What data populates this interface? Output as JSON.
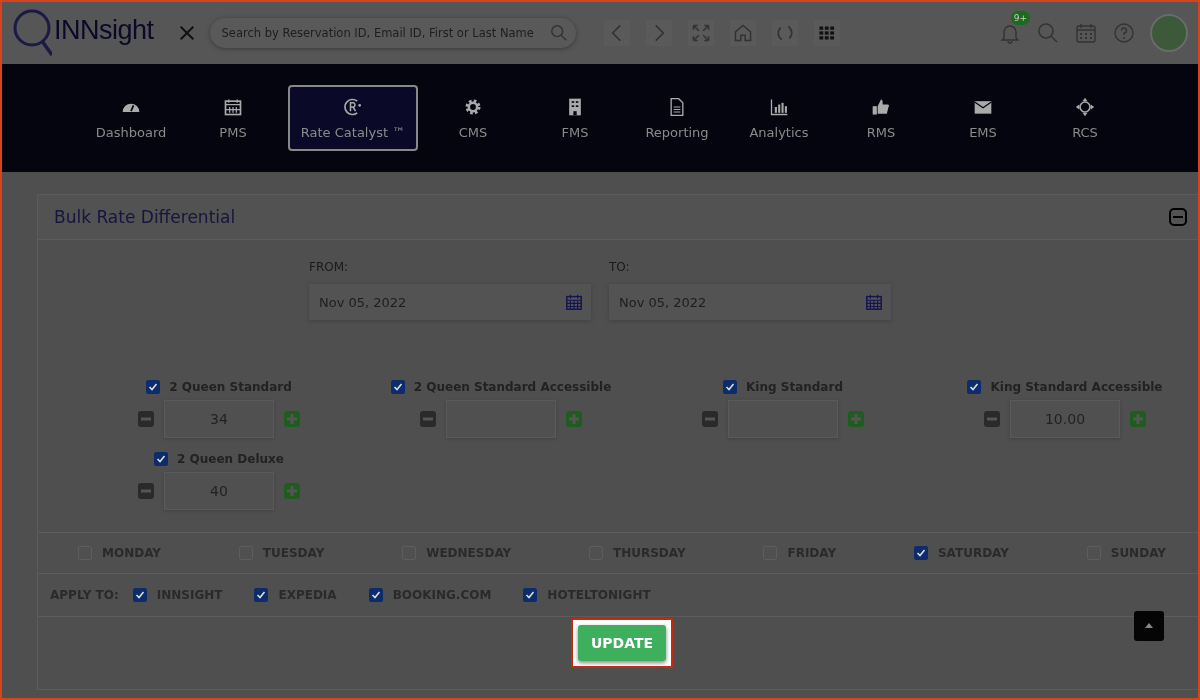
{
  "header": {
    "logo": "INNsight",
    "search": {
      "placeholder": "Search by Reservation ID, Email ID, First or Last Name"
    },
    "notification_badge": "9+"
  },
  "nav": [
    {
      "label": "Dashboard",
      "selected": false
    },
    {
      "label": "PMS",
      "selected": false
    },
    {
      "label": "Rate Catalyst ™",
      "selected": true
    },
    {
      "label": "CMS",
      "selected": false
    },
    {
      "label": "FMS",
      "selected": false
    },
    {
      "label": "Reporting",
      "selected": false
    },
    {
      "label": "Analytics",
      "selected": false
    },
    {
      "label": "RMS",
      "selected": false
    },
    {
      "label": "EMS",
      "selected": false
    },
    {
      "label": "RCS",
      "selected": false
    }
  ],
  "panel": {
    "title": "Bulk Rate Differential",
    "from": {
      "label": "FROM:",
      "value": "Nov 05, 2022"
    },
    "to": {
      "label": "TO:",
      "value": "Nov 05, 2022"
    }
  },
  "rooms": [
    {
      "name": "2 Queen Standard",
      "checked": true,
      "value": "34"
    },
    {
      "name": "2 Queen Standard Accessible",
      "checked": true
    },
    {
      "name": "King Standard",
      "checked": true
    },
    {
      "name": "King Standard Accessible",
      "checked": true,
      "value": "10.00"
    },
    {
      "name": "2 Queen Deluxe",
      "checked": true,
      "value": "40"
    }
  ],
  "days": [
    {
      "label": "MONDAY",
      "checked": false
    },
    {
      "label": "TUESDAY",
      "checked": false
    },
    {
      "label": "WEDNESDAY",
      "checked": false
    },
    {
      "label": "THURSDAY",
      "checked": false
    },
    {
      "label": "FRIDAY",
      "checked": false
    },
    {
      "label": "SATURDAY",
      "checked": true
    },
    {
      "label": "SUNDAY",
      "checked": false
    }
  ],
  "apply_to": {
    "label": "APPLY TO:",
    "channels": [
      {
        "label": "INNSIGHT",
        "checked": true
      },
      {
        "label": "EXPEDIA",
        "checked": true
      },
      {
        "label": "BOOKING.COM",
        "checked": true
      },
      {
        "label": "HOTELTONIGHT",
        "checked": true
      }
    ]
  },
  "update_button": {
    "label": "UPDATE",
    "highlighted": true
  }
}
